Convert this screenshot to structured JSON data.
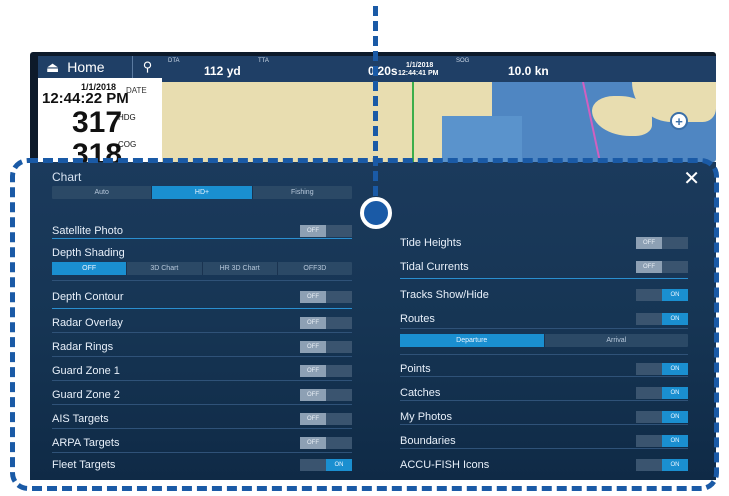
{
  "device": {
    "home_label": "Home",
    "date_value": "1/1/2018",
    "time_value": "12:44:22 PM",
    "date_label": "DATE",
    "hdg_value": "317",
    "hdg_label": "HDG",
    "cog_value": "318",
    "cog_label": "COG"
  },
  "databar": {
    "dta_label": "DTA",
    "dta_value": "112 yd",
    "tta_label": "TTA",
    "tta_value": "0'20s",
    "date_small": "1/1/2018",
    "time_small": "12:44:41 PM",
    "sog_label": "SOG",
    "sog_value": "10.0 kn"
  },
  "panel": {
    "title": "Chart",
    "chart_modes": [
      "Auto",
      "HD+",
      "Fishing"
    ],
    "chart_mode_selected": "HD+",
    "depth_modes": [
      "OFF",
      "3D Chart",
      "HR 3D Chart",
      "OFF3D"
    ],
    "depth_mode_selected": "OFF",
    "route_modes": [
      "Departure",
      "Arrival"
    ],
    "route_mode_selected": "Departure"
  },
  "left_rows": [
    {
      "label": "Satellite Photo",
      "state": "OFF"
    },
    {
      "label": "Depth Shading",
      "state": ""
    },
    {
      "label": "Depth Contour",
      "state": "OFF"
    },
    {
      "label": "Radar Overlay",
      "state": "OFF"
    },
    {
      "label": "Radar Rings",
      "state": "OFF"
    },
    {
      "label": "Guard Zone 1",
      "state": "OFF"
    },
    {
      "label": "Guard Zone 2",
      "state": "OFF"
    },
    {
      "label": "AIS Targets",
      "state": "OFF"
    },
    {
      "label": "ARPA Targets",
      "state": "OFF"
    },
    {
      "label": "Fleet Targets",
      "state": "ON"
    }
  ],
  "right_rows": [
    {
      "label": "Tide Heights",
      "state": "OFF"
    },
    {
      "label": "Tidal Currents",
      "state": "OFF"
    },
    {
      "label": "Tracks Show/Hide",
      "state": "ON"
    },
    {
      "label": "Routes",
      "state": "ON"
    },
    {
      "label": "Points",
      "state": "ON"
    },
    {
      "label": "Catches",
      "state": "ON"
    },
    {
      "label": "My Photos",
      "state": "ON"
    },
    {
      "label": "Boundaries",
      "state": "ON"
    },
    {
      "label": "ACCU-FISH Icons",
      "state": "ON"
    }
  ],
  "toggle_text": {
    "off": "OFF",
    "on": "ON"
  },
  "colors": {
    "accent": "#1a8fd0",
    "callout": "#1a5aa6",
    "panel_bg": "#163554"
  }
}
